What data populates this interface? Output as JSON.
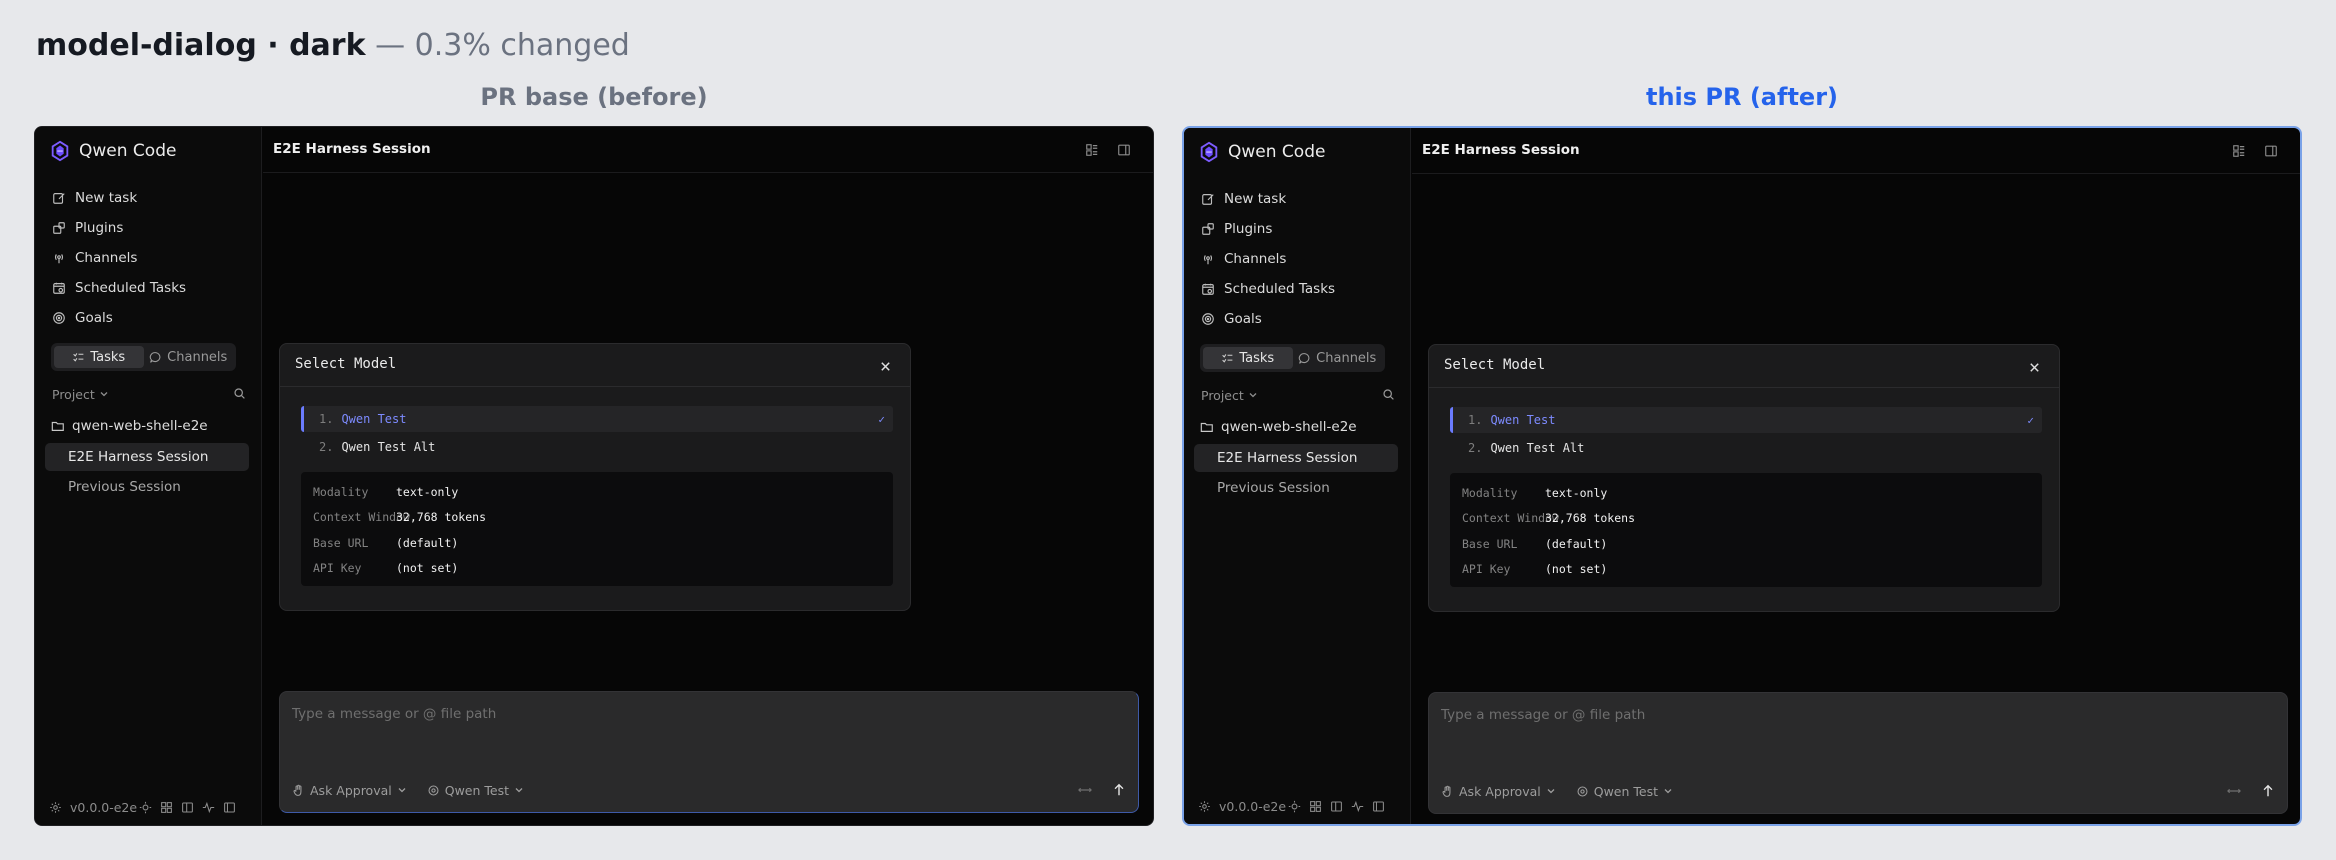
{
  "header": {
    "name": "model-dialog · dark",
    "meta": " — 0.3% changed"
  },
  "columns": {
    "before_label": "PR base (before)",
    "after_label": "this PR (after)",
    "after_accent": "#2563eb"
  },
  "app": {
    "brand": "Qwen Code",
    "nav": [
      "New task",
      "Plugins",
      "Channels",
      "Scheduled Tasks",
      "Goals"
    ],
    "tabs": {
      "tasks": "Tasks",
      "channels": "Channels"
    },
    "project_label": "Project",
    "folder": "qwen-web-shell-e2e",
    "sessions": [
      "E2E Harness Session",
      "Previous Session"
    ],
    "version": "v0.0.0-e2e",
    "session_title": "E2E Harness Session",
    "dialog": {
      "title": "Select Model",
      "options": [
        {
          "num": "1.",
          "label": "Qwen Test",
          "selected": true,
          "check": "✓"
        },
        {
          "num": "2.",
          "label": "Qwen Test Alt",
          "selected": false
        }
      ],
      "info": [
        {
          "key": "Modality",
          "value": "text-only"
        },
        {
          "key": "Context Window",
          "value": "32,768 tokens"
        },
        {
          "key": "Base URL",
          "value": "(default)"
        },
        {
          "key": "API Key",
          "value": "(not set)"
        }
      ]
    },
    "composer": {
      "placeholder": "Type a message or @ file path",
      "approval": "Ask Approval",
      "model": "Qwen Test"
    },
    "accent": "#6b7cff"
  }
}
